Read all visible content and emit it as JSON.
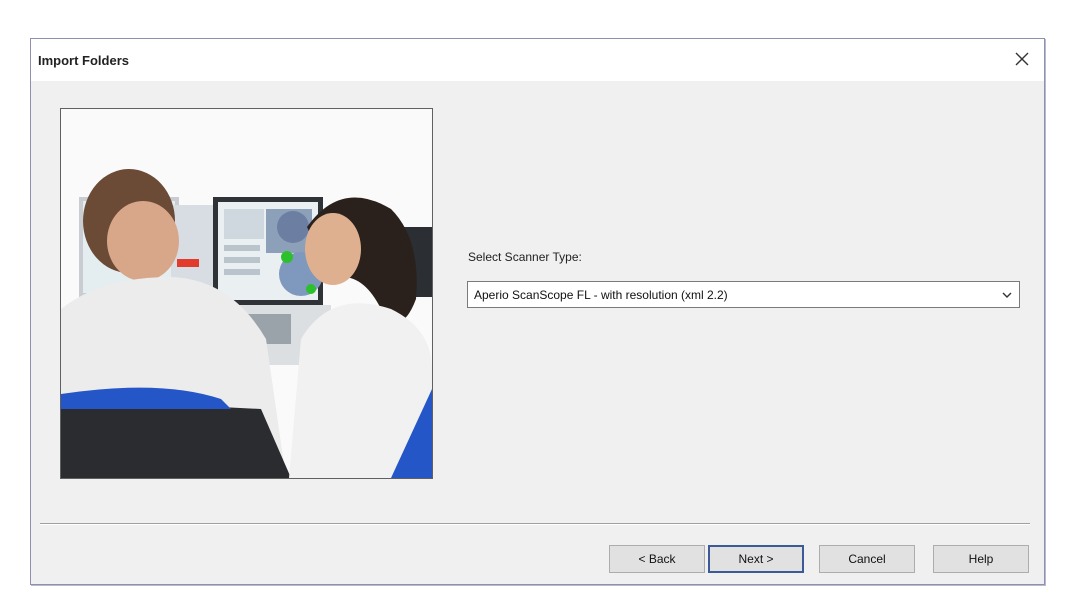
{
  "dialog": {
    "title": "Import Folders",
    "close_label": "×"
  },
  "scanner": {
    "label": "Select Scanner Type:",
    "selected": "Aperio ScanScope FL - with resolution (xml 2.2)"
  },
  "buttons": {
    "back": "< Back",
    "next": "Next >",
    "cancel": "Cancel",
    "help": "Help"
  },
  "colors": {
    "dialog_bg": "#f0f0f0",
    "titlebar_bg": "#ffffff",
    "border": "#8f8fae",
    "default_button_border": "#3c5a98",
    "button_bg": "#e1e1e1"
  },
  "icons": {
    "close": "close-icon",
    "dropdown": "chevron-down-icon",
    "illustration": "scientists-illustration"
  }
}
